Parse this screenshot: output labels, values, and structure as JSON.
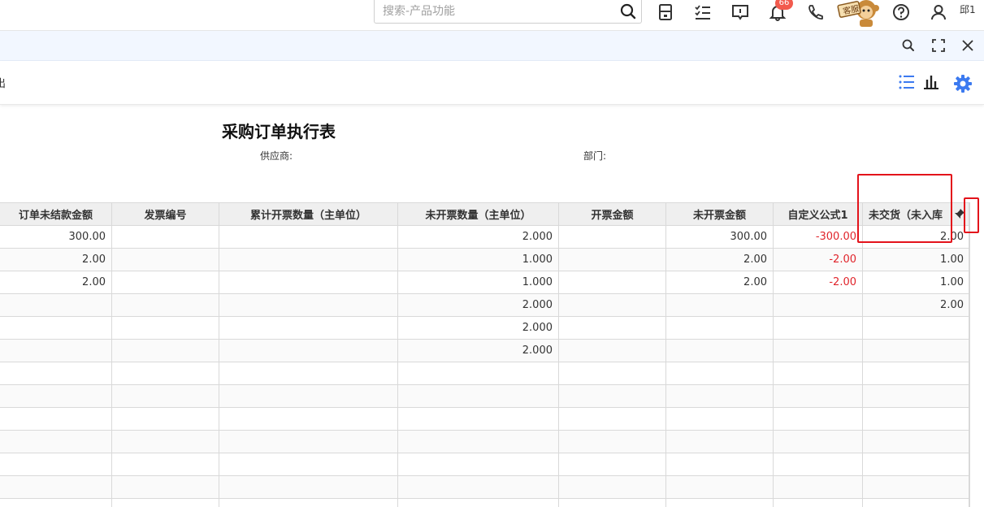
{
  "header": {
    "search_placeholder": "搜索-产品功能",
    "icons": [
      "search-icon",
      "calculator-icon",
      "task-list-icon",
      "message-icon",
      "bell-icon",
      "phone-icon",
      "customer-service-mascot-icon",
      "help-icon",
      "user-icon"
    ],
    "notification_count": "66",
    "mascot_label": "客服",
    "user_name": "邱1"
  },
  "subbar": {
    "icons": [
      "search-icon",
      "fullscreen-icon",
      "close-icon"
    ]
  },
  "toolbar": {
    "left_label": "出",
    "icons": [
      "list-view-icon",
      "chart-view-icon",
      "settings-gear-icon"
    ],
    "accent_color": "#3c7af0"
  },
  "report": {
    "title": "采购订单执行表",
    "supplier_label": "供应商:",
    "department_label": "部门:"
  },
  "table": {
    "columns": [
      "订单未结款金额",
      "发票编号",
      "累计开票数量（主单位）",
      "未开票数量（主单位）",
      "开票金额",
      "未开票金额",
      "自定义公式1",
      "未交货（未入库"
    ],
    "rows": [
      [
        "300.00",
        "",
        "",
        "2.000",
        "",
        "300.00",
        "-300.00",
        "2.00"
      ],
      [
        "2.00",
        "",
        "",
        "1.000",
        "",
        "2.00",
        "-2.00",
        "1.00"
      ],
      [
        "2.00",
        "",
        "",
        "1.000",
        "",
        "2.00",
        "-2.00",
        "1.00"
      ],
      [
        "",
        "",
        "",
        "2.000",
        "",
        "",
        "",
        "2.00"
      ],
      [
        "",
        "",
        "",
        "2.000",
        "",
        "",
        "",
        ""
      ],
      [
        "",
        "",
        "",
        "2.000",
        "",
        "",
        "",
        ""
      ],
      [
        "",
        "",
        "",
        "",
        "",
        "",
        "",
        ""
      ],
      [
        "",
        "",
        "",
        "",
        "",
        "",
        "",
        ""
      ],
      [
        "",
        "",
        "",
        "",
        "",
        "",
        "",
        ""
      ],
      [
        "",
        "",
        "",
        "",
        "",
        "",
        "",
        ""
      ],
      [
        "",
        "",
        "",
        "",
        "",
        "",
        "",
        ""
      ],
      [
        "",
        "",
        "",
        "",
        "",
        "",
        "",
        ""
      ],
      [
        "",
        "",
        "",
        "",
        "",
        "",
        "",
        ""
      ]
    ],
    "negative_color": "#e0242b"
  },
  "annotation_color": "#e3131b"
}
